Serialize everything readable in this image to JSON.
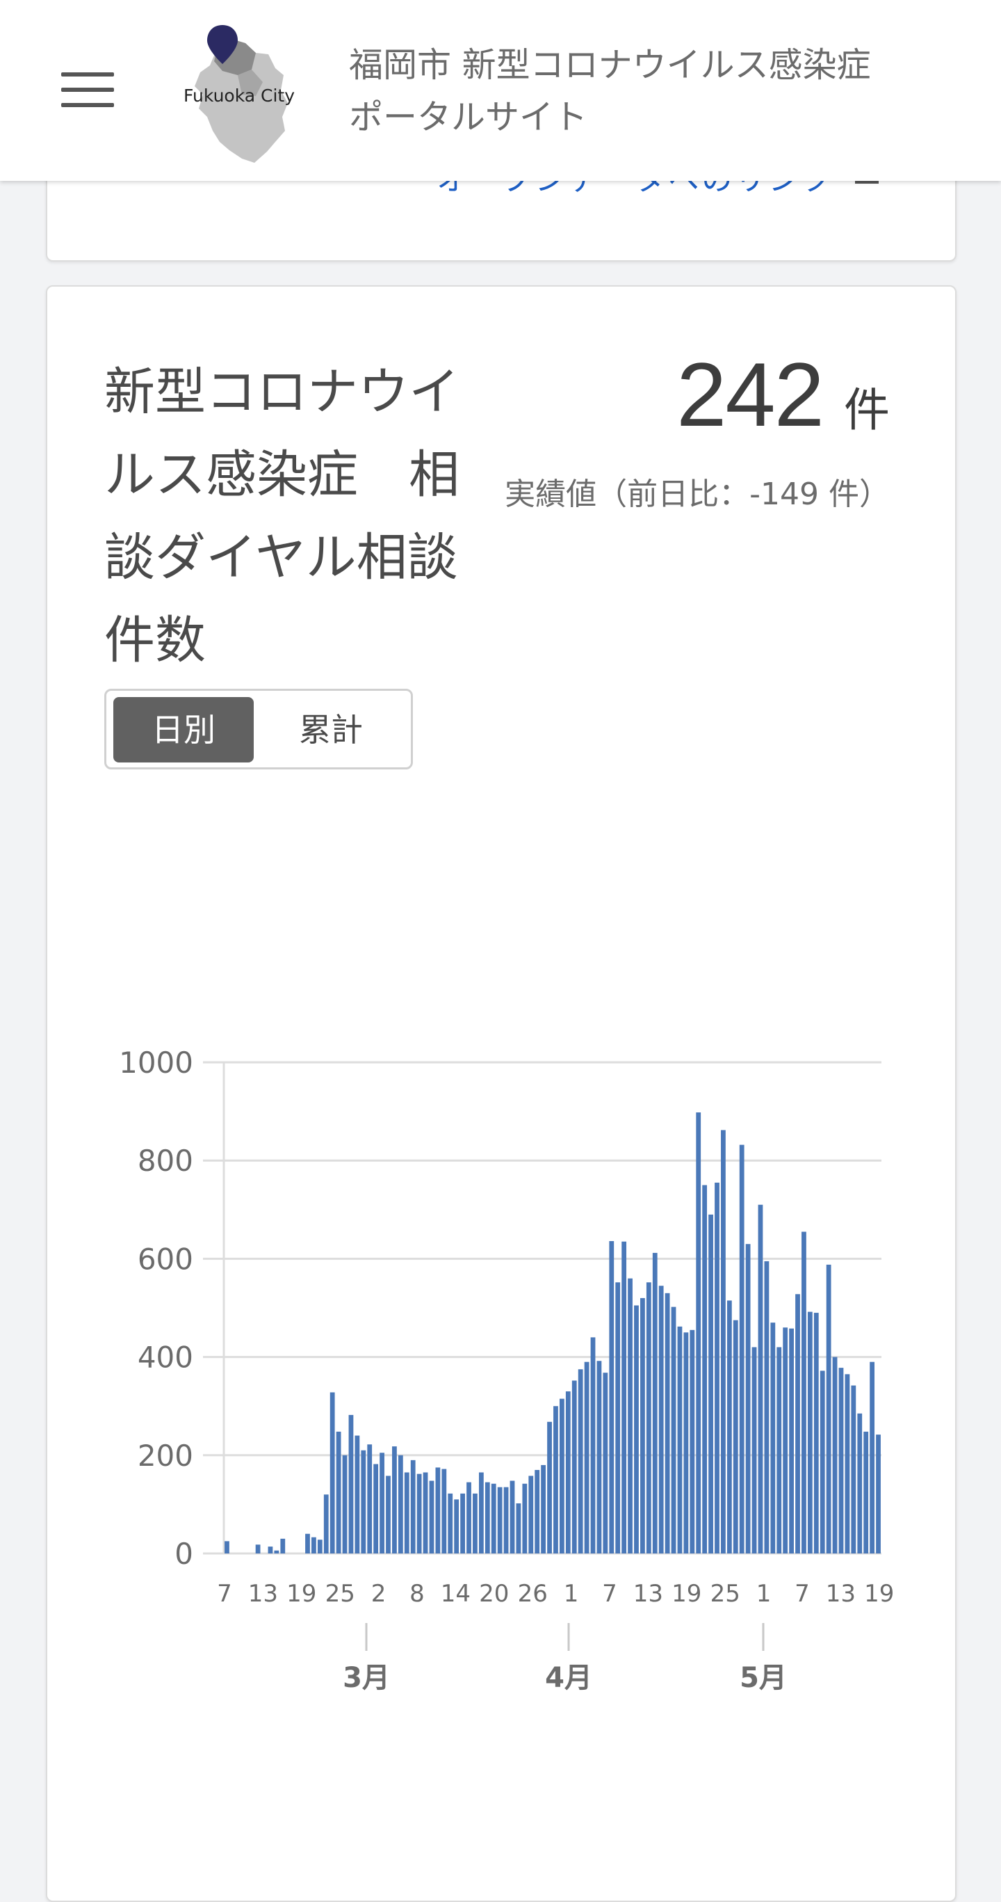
{
  "header": {
    "logo_text": "Fukuoka City",
    "title_line1": "福岡市 新型コロナウイルス感染症",
    "title_line2": "ポータルサイト"
  },
  "top_card": {
    "link_text": "オープンデータへのリンク"
  },
  "card": {
    "title_lines": [
      "新型コロナウイ",
      "ルス感染症　相",
      "談ダイヤル相談",
      "件数"
    ],
    "value": "242",
    "unit": "件",
    "sub_label": "実績値（前日比：-149 件）",
    "toggle": {
      "daily": "日別",
      "cumulative": "累計"
    }
  },
  "chart_data": {
    "type": "bar",
    "ylim": [
      0,
      1000
    ],
    "yticks": [
      0,
      200,
      400,
      600,
      800,
      1000
    ],
    "bar_color": "#4a78b8",
    "x_tick_labels": [
      "7",
      "13",
      "19",
      "25",
      "2",
      "8",
      "14",
      "20",
      "26",
      "1",
      "7",
      "13",
      "19",
      "25",
      "1",
      "7",
      "13",
      "19"
    ],
    "month_labels": [
      "3月",
      "4月",
      "5月"
    ],
    "values": [
      25,
      0,
      0,
      0,
      0,
      18,
      0,
      14,
      6,
      30,
      0,
      0,
      0,
      40,
      33,
      28,
      120,
      328,
      248,
      200,
      282,
      240,
      210,
      222,
      182,
      205,
      158,
      218,
      200,
      165,
      190,
      162,
      165,
      148,
      175,
      172,
      122,
      110,
      122,
      145,
      122,
      165,
      145,
      142,
      135,
      135,
      148,
      102,
      142,
      158,
      170,
      180,
      268,
      300,
      315,
      330,
      352,
      375,
      390,
      440,
      392,
      368,
      636,
      552,
      635,
      560,
      505,
      520,
      552,
      612,
      545,
      530,
      502,
      462,
      450,
      455,
      898,
      750,
      690,
      755,
      862,
      515,
      475,
      832,
      630,
      420,
      710,
      595,
      470,
      420,
      460,
      458,
      528,
      655,
      492,
      490,
      372,
      588,
      400,
      378,
      365,
      342,
      285,
      248,
      390,
      242
    ]
  }
}
